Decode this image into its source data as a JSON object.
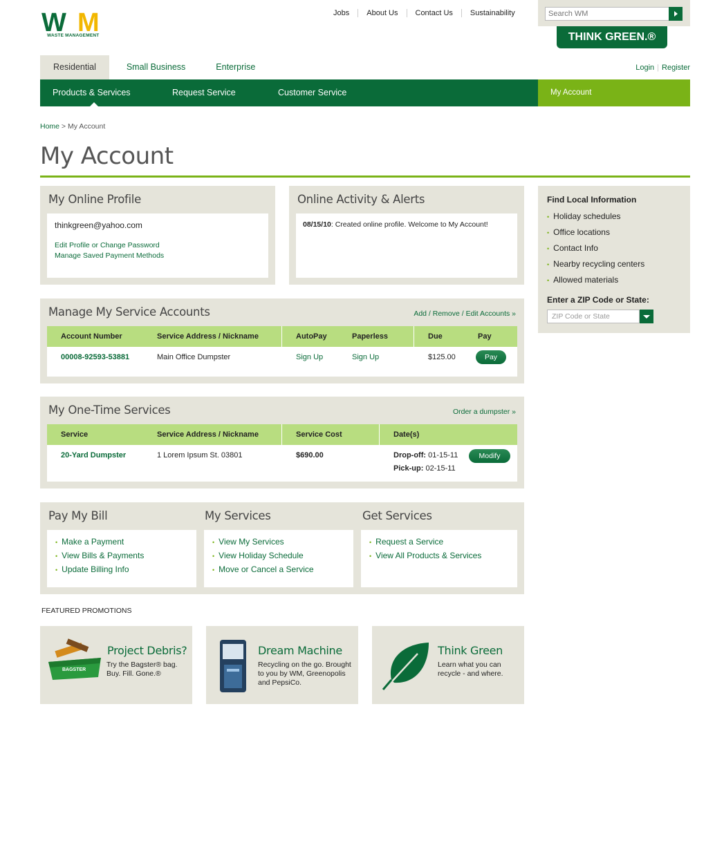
{
  "brand": {
    "logo_text": "WM",
    "logo_sub": "WASTE MANAGEMENT",
    "tagline": "THINK GREEN.®",
    "colors": {
      "green": "#0a6b39",
      "lime": "#7ab317",
      "panel": "#e5e4da",
      "table_head": "#b8dd80"
    }
  },
  "top_links": [
    "Jobs",
    "About Us",
    "Contact Us",
    "Sustainability"
  ],
  "search": {
    "placeholder": "Search WM"
  },
  "segments": [
    "Residential",
    "Small Business",
    "Enterprise"
  ],
  "auth": {
    "login": "Login",
    "register": "Register"
  },
  "nav": {
    "items": [
      "Products & Services",
      "Request Service",
      "Customer Service"
    ],
    "my_account": "My Account"
  },
  "breadcrumb": {
    "home": "Home",
    "sep": " > ",
    "current": "My Account"
  },
  "page_title": "My Account",
  "profile": {
    "title": "My Online Profile",
    "email": "thinkgreen@yahoo.com",
    "links": [
      "Edit Profile or Change Password",
      "Manage Saved Payment Methods"
    ]
  },
  "activity": {
    "title": "Online Activity & Alerts",
    "date": "08/15/10",
    "message": ": Created online profile.  Welcome to My Account!"
  },
  "service_accounts": {
    "title": "Manage My Service Accounts",
    "action": "Add / Remove / Edit Accounts »",
    "headers": [
      "Account Number",
      "Service Address / Nickname",
      "AutoPay",
      "Paperless",
      "Due",
      "Pay"
    ],
    "row": {
      "account": "00008-92593-53881",
      "address": "Main Office Dumpster",
      "autopay": "Sign Up",
      "paperless": "Sign Up",
      "due": "$125.00",
      "pay": "Pay"
    }
  },
  "one_time": {
    "title": "My One-Time Services",
    "action": "Order a dumpster »",
    "headers": [
      "Service",
      "Service Address / Nickname",
      "Service Cost",
      "Date(s)"
    ],
    "row": {
      "service": "20-Yard Dumpster",
      "address": "1 Lorem Ipsum St. 03801",
      "cost": "$690.00",
      "dropoff_label": "Drop-off:",
      "dropoff": " 01-15-11",
      "pickup_label": "Pick-up:",
      "pickup": " 02-15-11",
      "modify": "Modify"
    }
  },
  "pay_bill": {
    "title": "Pay My Bill",
    "items": [
      "Make a Payment",
      "View Bills & Payments",
      "Update Billing Info"
    ]
  },
  "my_services": {
    "title": "My Services",
    "items": [
      "View My Services",
      "View Holiday Schedule",
      "Move or Cancel a Service"
    ]
  },
  "get_services": {
    "title": "Get Services",
    "items": [
      "Request a Service",
      "View All Products & Services"
    ]
  },
  "sidebar": {
    "title": "Find Local Information",
    "items": [
      "Holiday schedules",
      "Office locations",
      "Contact Info",
      "Nearby recycling centers",
      "Allowed materials"
    ],
    "zip_label": "Enter a ZIP Code or State:",
    "zip_placeholder": "ZIP Code or State"
  },
  "featured_label": "FEATURED PROMOTIONS",
  "promos": [
    {
      "title": "Project Debris?",
      "text": "Try the Bagster® bag. Buy. Fill.  Gone.®",
      "image_label": "BAGSTER"
    },
    {
      "title": "Dream Machine",
      "text": "Recycling on the go. Brought to you by WM, Greenopolis and PepsiCo."
    },
    {
      "title": "Think Green",
      "text": "Learn what you can recycle - and where."
    }
  ]
}
